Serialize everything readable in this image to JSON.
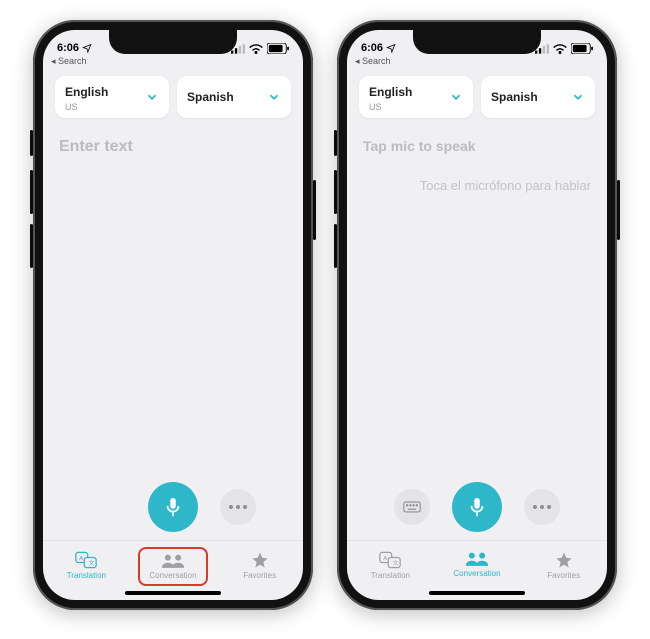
{
  "status": {
    "time": "6:06",
    "back_app": "Search"
  },
  "languages": {
    "left": {
      "name": "English",
      "sub": "US"
    },
    "right": {
      "name": "Spanish",
      "sub": ""
    }
  },
  "phone1": {
    "placeholder": "Enter text",
    "tabs": {
      "translation": "Translation",
      "conversation": "Conversation",
      "favorites": "Favorites",
      "active": "translation"
    }
  },
  "phone2": {
    "prompt_primary": "Tap mic to speak",
    "prompt_secondary": "Toca el micrófono para hablar",
    "tabs": {
      "translation": "Translation",
      "conversation": "Conversation",
      "favorites": "Favorites",
      "active": "conversation"
    }
  },
  "colors": {
    "accent": "#2eb7c9",
    "highlight": "#d73b2d"
  }
}
